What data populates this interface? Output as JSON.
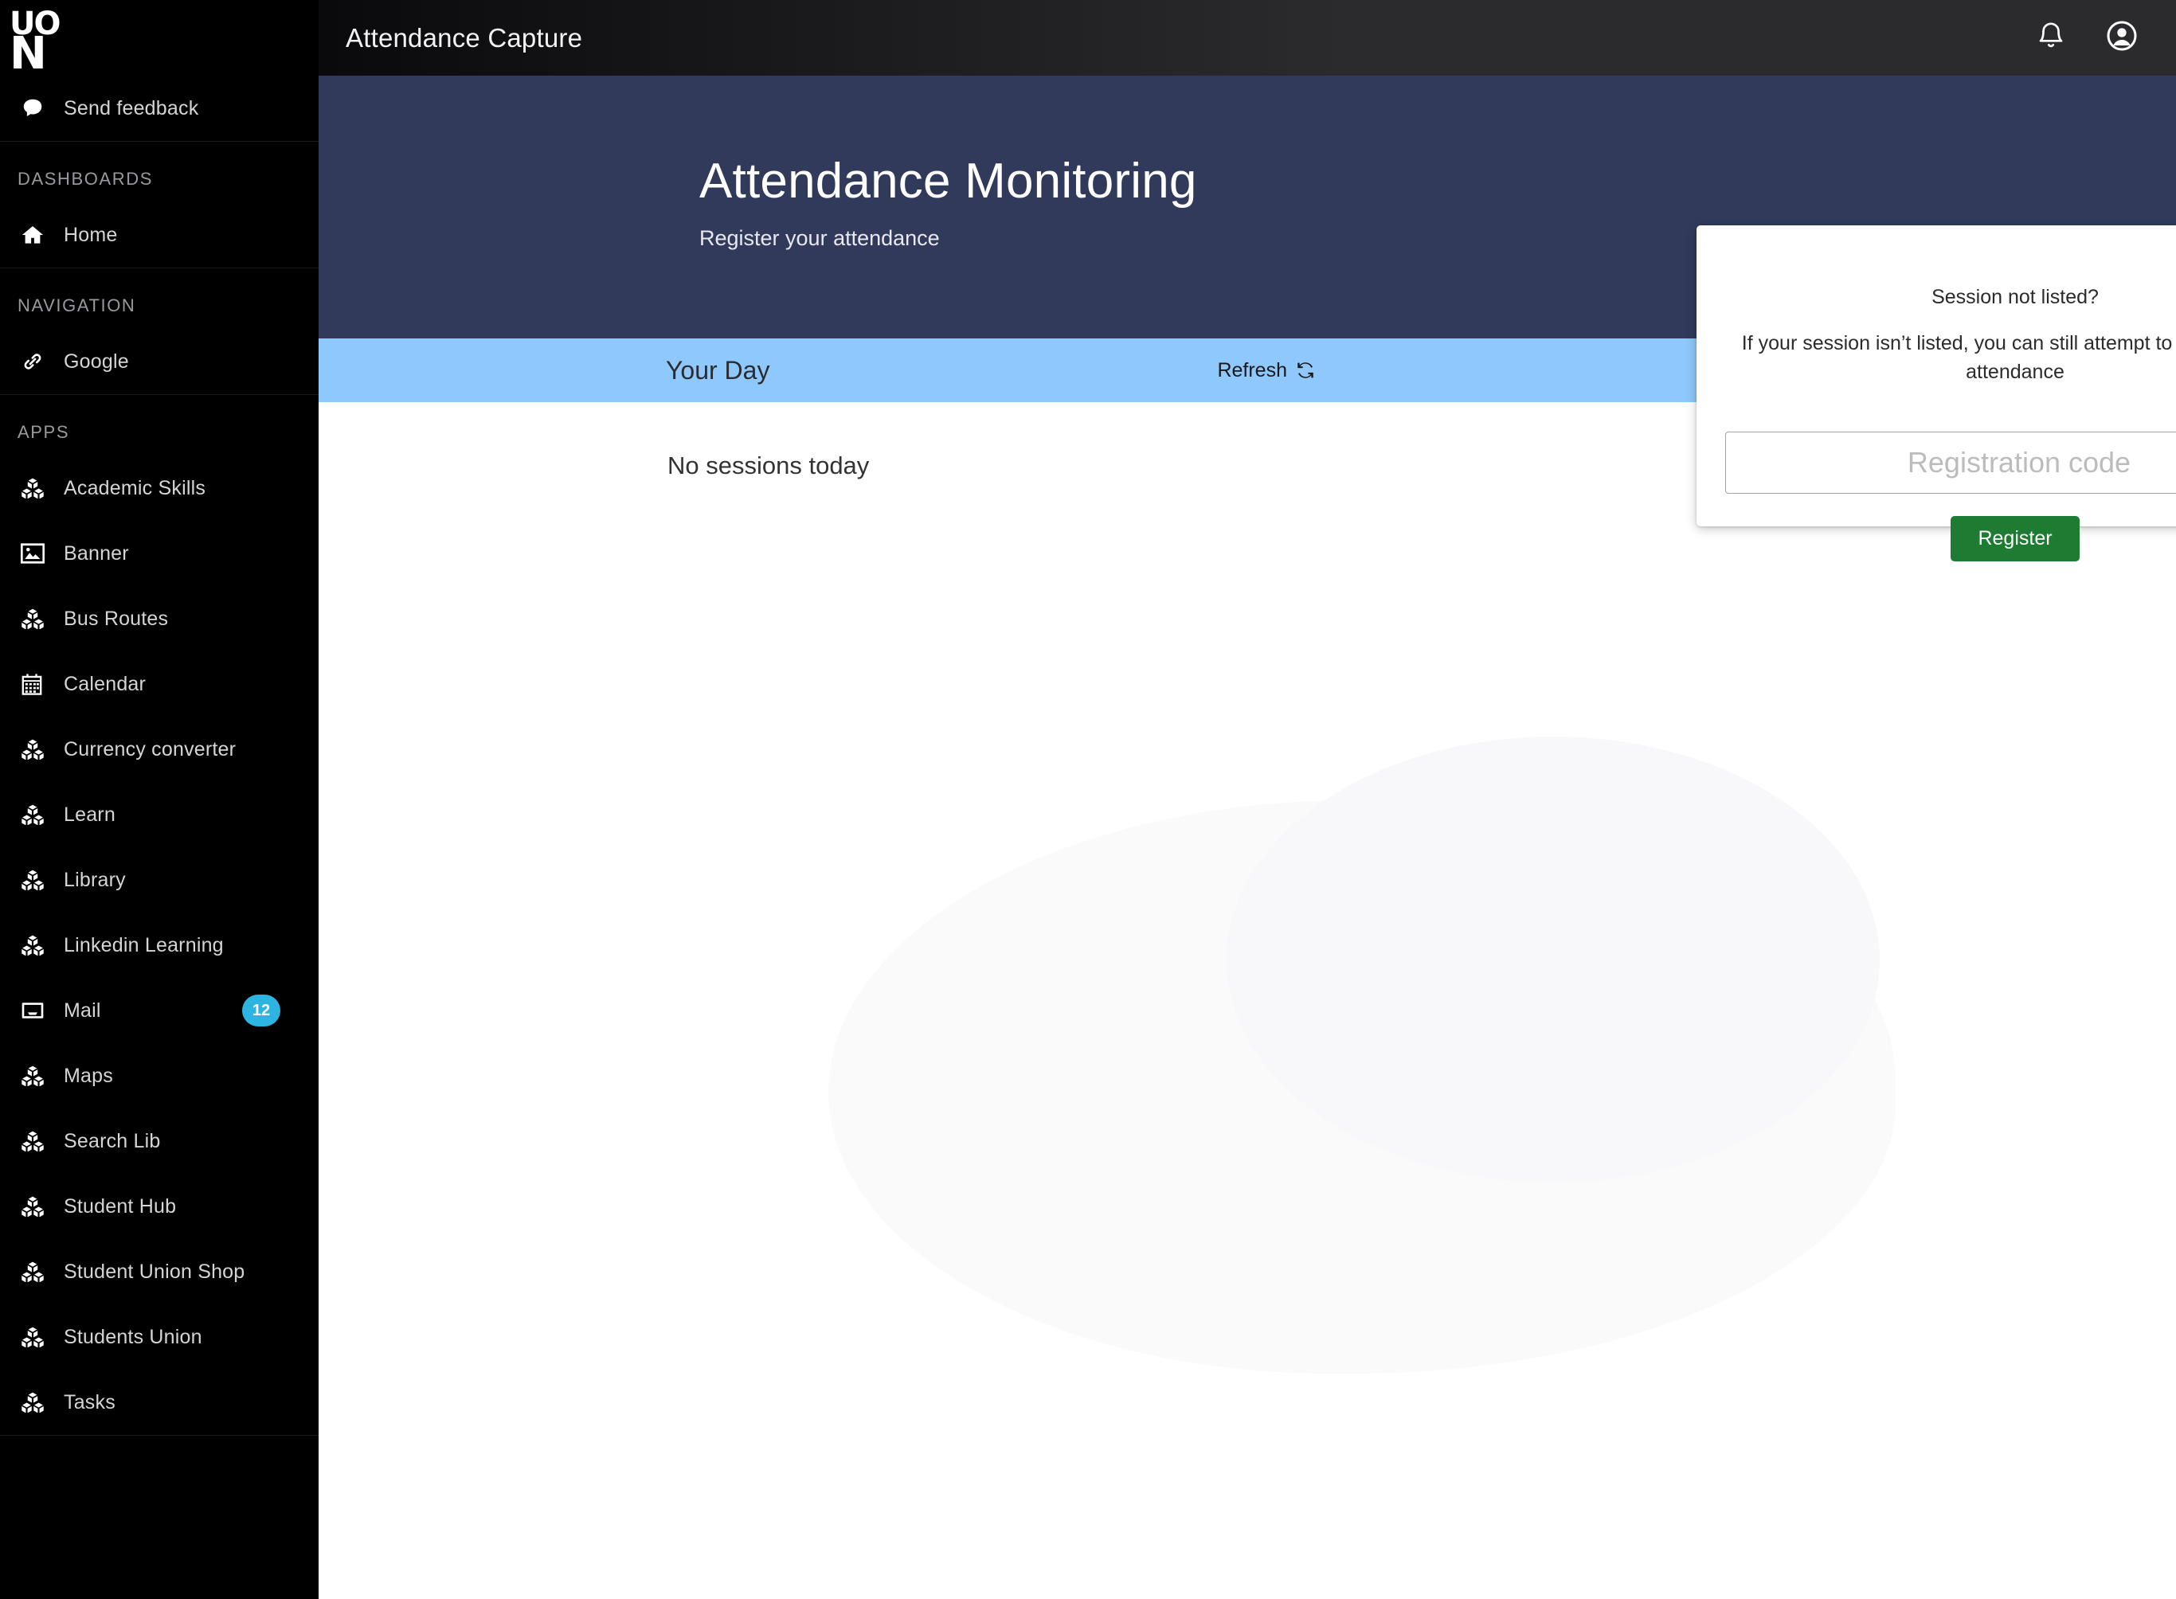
{
  "brand": {
    "logo_top": "UO",
    "logo_bottom": "N",
    "name": "University of Northampton"
  },
  "topbar": {
    "title": "Attendance Capture",
    "notifications_icon": "bell-icon",
    "account_icon": "user-circle-icon"
  },
  "sidebar": {
    "feedback": {
      "label": "Send feedback",
      "icon": "comment-icon"
    },
    "sections": [
      {
        "heading": "DASHBOARDS",
        "items": [
          {
            "label": "Home",
            "icon": "home-icon"
          }
        ]
      },
      {
        "heading": "NAVIGATION",
        "items": [
          {
            "label": "Google",
            "icon": "link-icon"
          }
        ]
      },
      {
        "heading": "APPS",
        "items": [
          {
            "label": "Academic Skills",
            "icon": "cubes-icon"
          },
          {
            "label": "Banner",
            "icon": "image-icon"
          },
          {
            "label": "Bus Routes",
            "icon": "cubes-icon"
          },
          {
            "label": "Calendar",
            "icon": "calendar-icon"
          },
          {
            "label": "Currency converter",
            "icon": "cubes-icon"
          },
          {
            "label": "Learn",
            "icon": "cubes-icon"
          },
          {
            "label": "Library",
            "icon": "cubes-icon"
          },
          {
            "label": "Linkedin Learning",
            "icon": "cubes-icon"
          },
          {
            "label": "Mail",
            "icon": "inbox-icon",
            "badge": "12"
          },
          {
            "label": "Maps",
            "icon": "cubes-icon"
          },
          {
            "label": "Search Lib",
            "icon": "cubes-icon"
          },
          {
            "label": "Student Hub",
            "icon": "cubes-icon"
          },
          {
            "label": "Student Union Shop",
            "icon": "cubes-icon"
          },
          {
            "label": "Students Union",
            "icon": "cubes-icon"
          },
          {
            "label": "Tasks",
            "icon": "cubes-icon"
          }
        ]
      }
    ]
  },
  "hero": {
    "title": "Attendance Monitoring",
    "subtitle": "Register your attendance"
  },
  "daybar": {
    "title": "Your Day",
    "refresh_label": "Refresh",
    "refresh_icon": "refresh-icon"
  },
  "content": {
    "empty_message": "No sessions today"
  },
  "modal": {
    "title": "Session not listed?",
    "body": "If your session isn’t listed, you can still attempt to register your attendance",
    "code_input_value": "",
    "code_input_placeholder": "Registration code",
    "register_label": "Register"
  },
  "colors": {
    "sidebar_bg": "#000000",
    "topbar_bg": "#2b2b2e",
    "hero_bg": "#323a5c",
    "daybar_bg": "#8ec8fc",
    "badge_bg": "#2eb4e0",
    "register_green": "#1e7b32",
    "page_bg": "#ffffff"
  }
}
